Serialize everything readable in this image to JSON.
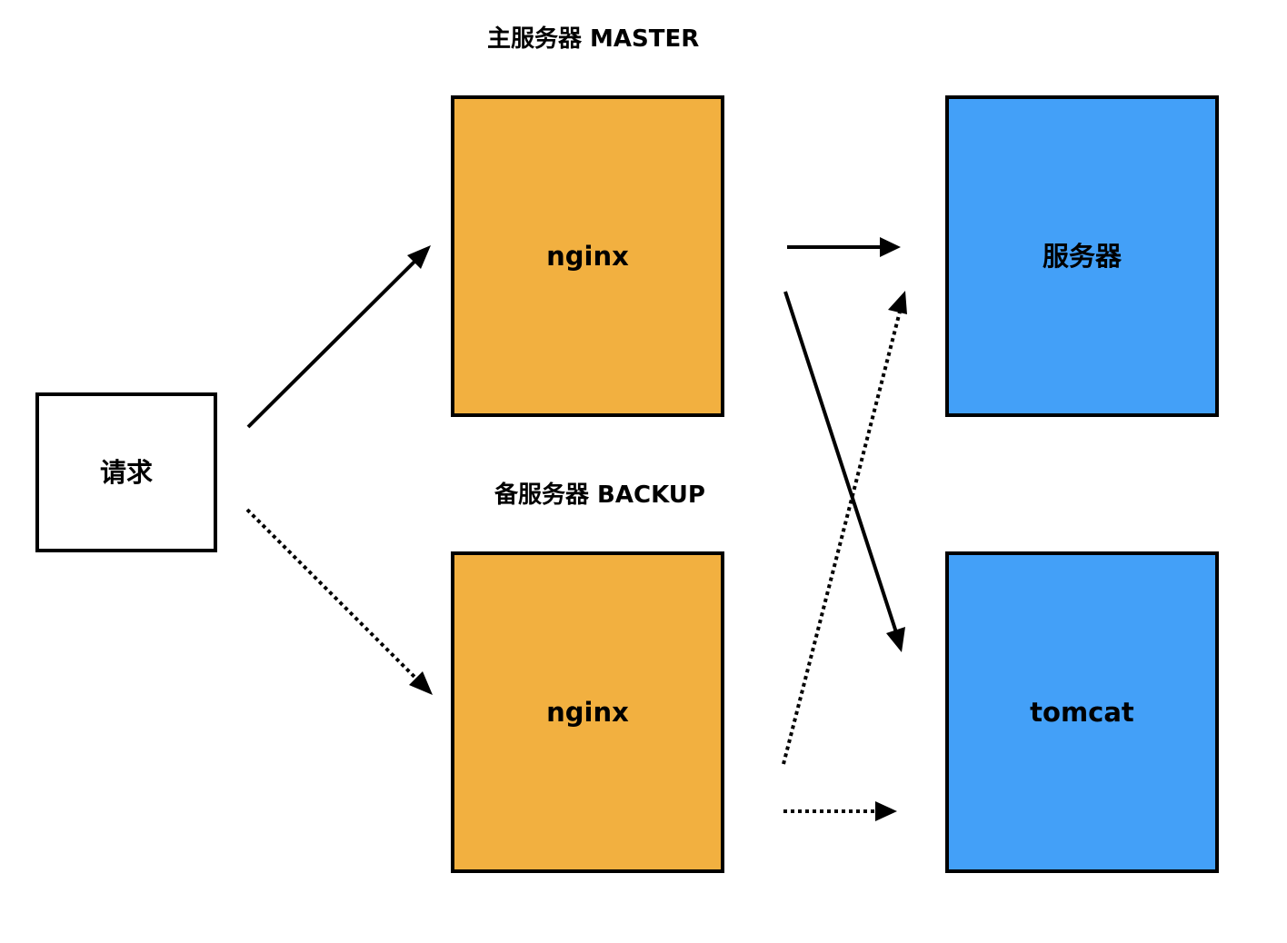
{
  "labels": {
    "master": "主服务器 MASTER",
    "backup": "备服务器 BACKUP"
  },
  "nodes": {
    "request": "请求",
    "nginx_master": "nginx",
    "nginx_backup": "nginx",
    "server": "服务器",
    "tomcat": "tomcat"
  },
  "colors": {
    "nginx": "#F2B040",
    "backend": "#43A0F8",
    "request": "#FFFFFF",
    "stroke": "#000000"
  },
  "edges": [
    {
      "from": "request",
      "to": "nginx_master",
      "style": "solid"
    },
    {
      "from": "request",
      "to": "nginx_backup",
      "style": "dotted"
    },
    {
      "from": "nginx_master",
      "to": "server",
      "style": "solid"
    },
    {
      "from": "nginx_master",
      "to": "tomcat",
      "style": "solid"
    },
    {
      "from": "nginx_backup",
      "to": "server",
      "style": "dotted"
    },
    {
      "from": "nginx_backup",
      "to": "tomcat",
      "style": "dotted"
    }
  ]
}
